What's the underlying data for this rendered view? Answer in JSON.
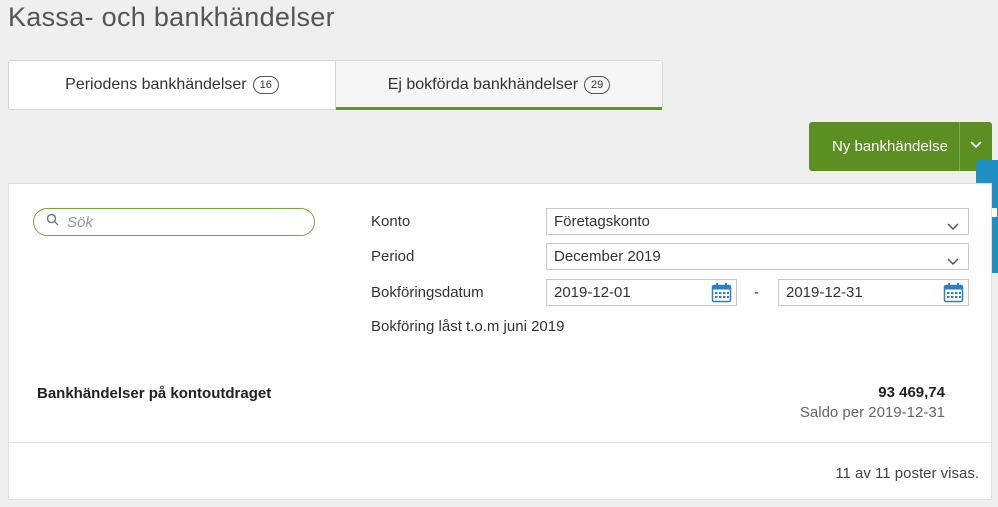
{
  "page": {
    "title": "Kassa- och bankhändelser"
  },
  "tabs": [
    {
      "label": "Periodens bankhändelser",
      "count": "16",
      "active": false
    },
    {
      "label": "Ej bokförda bankhändelser",
      "count": "29",
      "active": true
    }
  ],
  "actions": {
    "new_button_label": "Ny bankhändelse"
  },
  "search": {
    "placeholder": "Sök",
    "value": ""
  },
  "filters": {
    "konto_label": "Konto",
    "konto_value": "Företagskonto",
    "period_label": "Period",
    "period_value": "December 2019",
    "date_label": "Bokföringsdatum",
    "date_from": "2019-12-01",
    "date_separator": "-",
    "date_to": "2019-12-31",
    "lock_note": "Bokföring låst t.o.m juni 2019"
  },
  "summary": {
    "label": "Bankhändelser på kontoutdraget",
    "amount": "93 469,74",
    "balance_note": "Saldo per 2019-12-31"
  },
  "footer": {
    "count_text": "11 av 11 poster visas."
  },
  "icons": {
    "search": "search-icon",
    "chevron": "chevron-down-icon",
    "calendar": "calendar-icon",
    "chat": "chat-icon"
  },
  "colors": {
    "accent_green": "#5c8f22",
    "tab_underline": "#5a9a1f",
    "search_border": "#6fa93a",
    "side_tab_blue": "#1f8ec4",
    "calendar_blue": "#2b7fc7"
  }
}
